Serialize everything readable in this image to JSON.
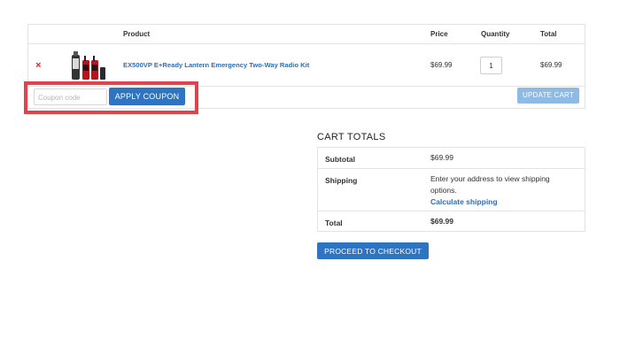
{
  "table": {
    "headers": {
      "product": "Product",
      "price": "Price",
      "quantity": "Quantity",
      "total": "Total"
    },
    "item": {
      "remove": "×",
      "name": "EX500VP E+Ready Lantern Emergency Two-Way Radio Kit",
      "price": "$69.99",
      "quantity": "1",
      "total": "$69.99"
    }
  },
  "coupon": {
    "placeholder": "Coupon code",
    "apply_label": "APPLY COUPON"
  },
  "update_label": "UPDATE CART",
  "totals": {
    "title": "CART TOTALS",
    "subtotal_label": "Subtotal",
    "subtotal_value": "$69.99",
    "shipping_label": "Shipping",
    "shipping_text": "Enter your address to view shipping options.",
    "calculate_link": "Calculate shipping",
    "total_label": "Total",
    "total_value": "$69.99"
  },
  "checkout_label": "PROCEED TO CHECKOUT",
  "colors": {
    "accent": "#2f74c0",
    "link": "#2a6ebb",
    "remove": "#e02b2b",
    "highlight": "#e0434b"
  }
}
